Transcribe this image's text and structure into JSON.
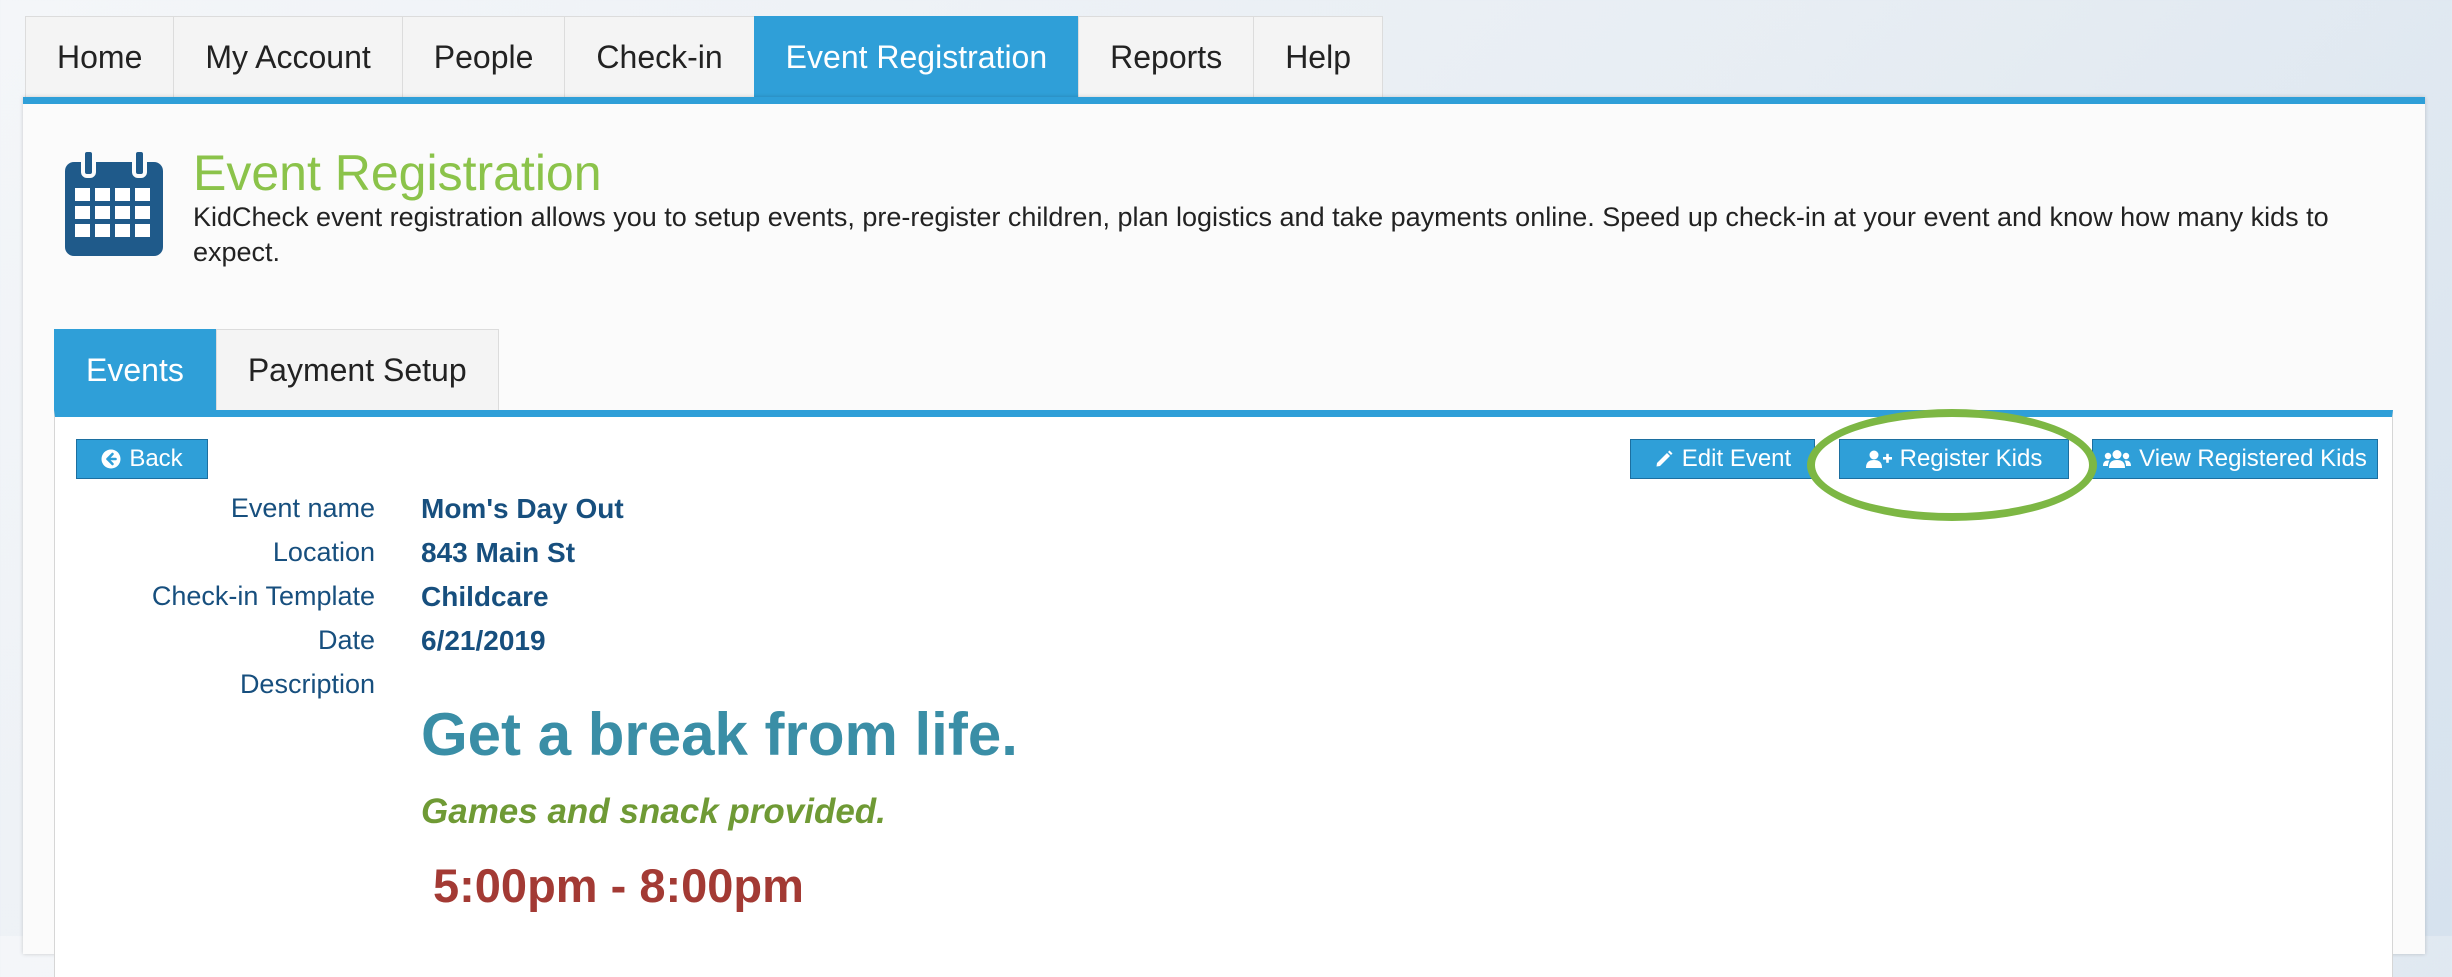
{
  "nav": {
    "tabs": [
      "Home",
      "My Account",
      "People",
      "Check-in",
      "Event Registration",
      "Reports",
      "Help"
    ],
    "active": "Event Registration"
  },
  "header": {
    "title": "Event Registration",
    "description": "KidCheck event registration allows you to setup events, pre-register children, plan logistics and take payments online. Speed up check-in at your event and know how many kids to expect."
  },
  "subtabs": {
    "tabs": [
      "Events",
      "Payment Setup"
    ],
    "active": "Events"
  },
  "toolbar": {
    "back_label": "Back",
    "edit_label": "Edit Event",
    "register_label": "Register Kids",
    "view_label": "View Registered Kids"
  },
  "event": {
    "name_label": "Event name",
    "name": "Mom's Day Out",
    "location_label": "Location",
    "location": "843 Main St",
    "template_label": "Check-in Template",
    "template": "Childcare",
    "date_label": "Date",
    "date": "6/21/2019",
    "description_label": "Description",
    "description": {
      "headline": "Get a break from life.",
      "subhead": "Games and snack provided.",
      "time": "5:00pm - 8:00pm"
    }
  },
  "colors": {
    "accent": "#2f9fd8",
    "title_green": "#8bc34a",
    "highlight_ring": "#7db744",
    "label_blue": "#174f7e",
    "headline": "#3a8ea6",
    "subhead": "#6f9a35",
    "time": "#a33a34"
  },
  "icons": {
    "header": "calendar-icon",
    "back": "arrow-circle-left-icon",
    "edit": "pencil-icon",
    "register": "user-plus-icon",
    "view": "users-icon"
  }
}
